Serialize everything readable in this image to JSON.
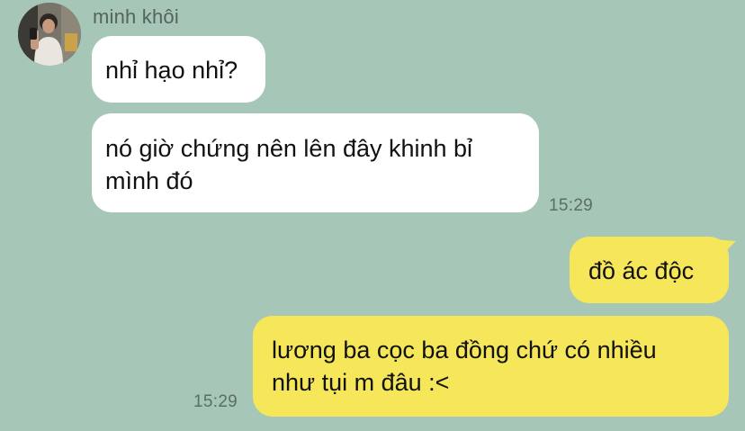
{
  "chat": {
    "sender_name": "minh khôi",
    "avatar": {
      "icon": "profile-photo"
    },
    "messages": [
      {
        "direction": "incoming",
        "text": "nhỉ hạo nhỉ?"
      },
      {
        "direction": "incoming",
        "text": "nó giờ chứng nên lên đây khinh bỉ\nmình đó",
        "time": "15:29"
      },
      {
        "direction": "outgoing",
        "text": "đồ ác độc"
      },
      {
        "direction": "outgoing",
        "text": "lương ba cọc ba đồng chứ có nhiều\nnhư tụi m đâu :<",
        "time": "15:29"
      }
    ]
  },
  "colors": {
    "background": "#a6c6b7",
    "incoming_bubble": "#ffffff",
    "outgoing_bubble": "#f6e65a",
    "timestamp": "#5b6e64",
    "sender_name": "#55645c"
  }
}
